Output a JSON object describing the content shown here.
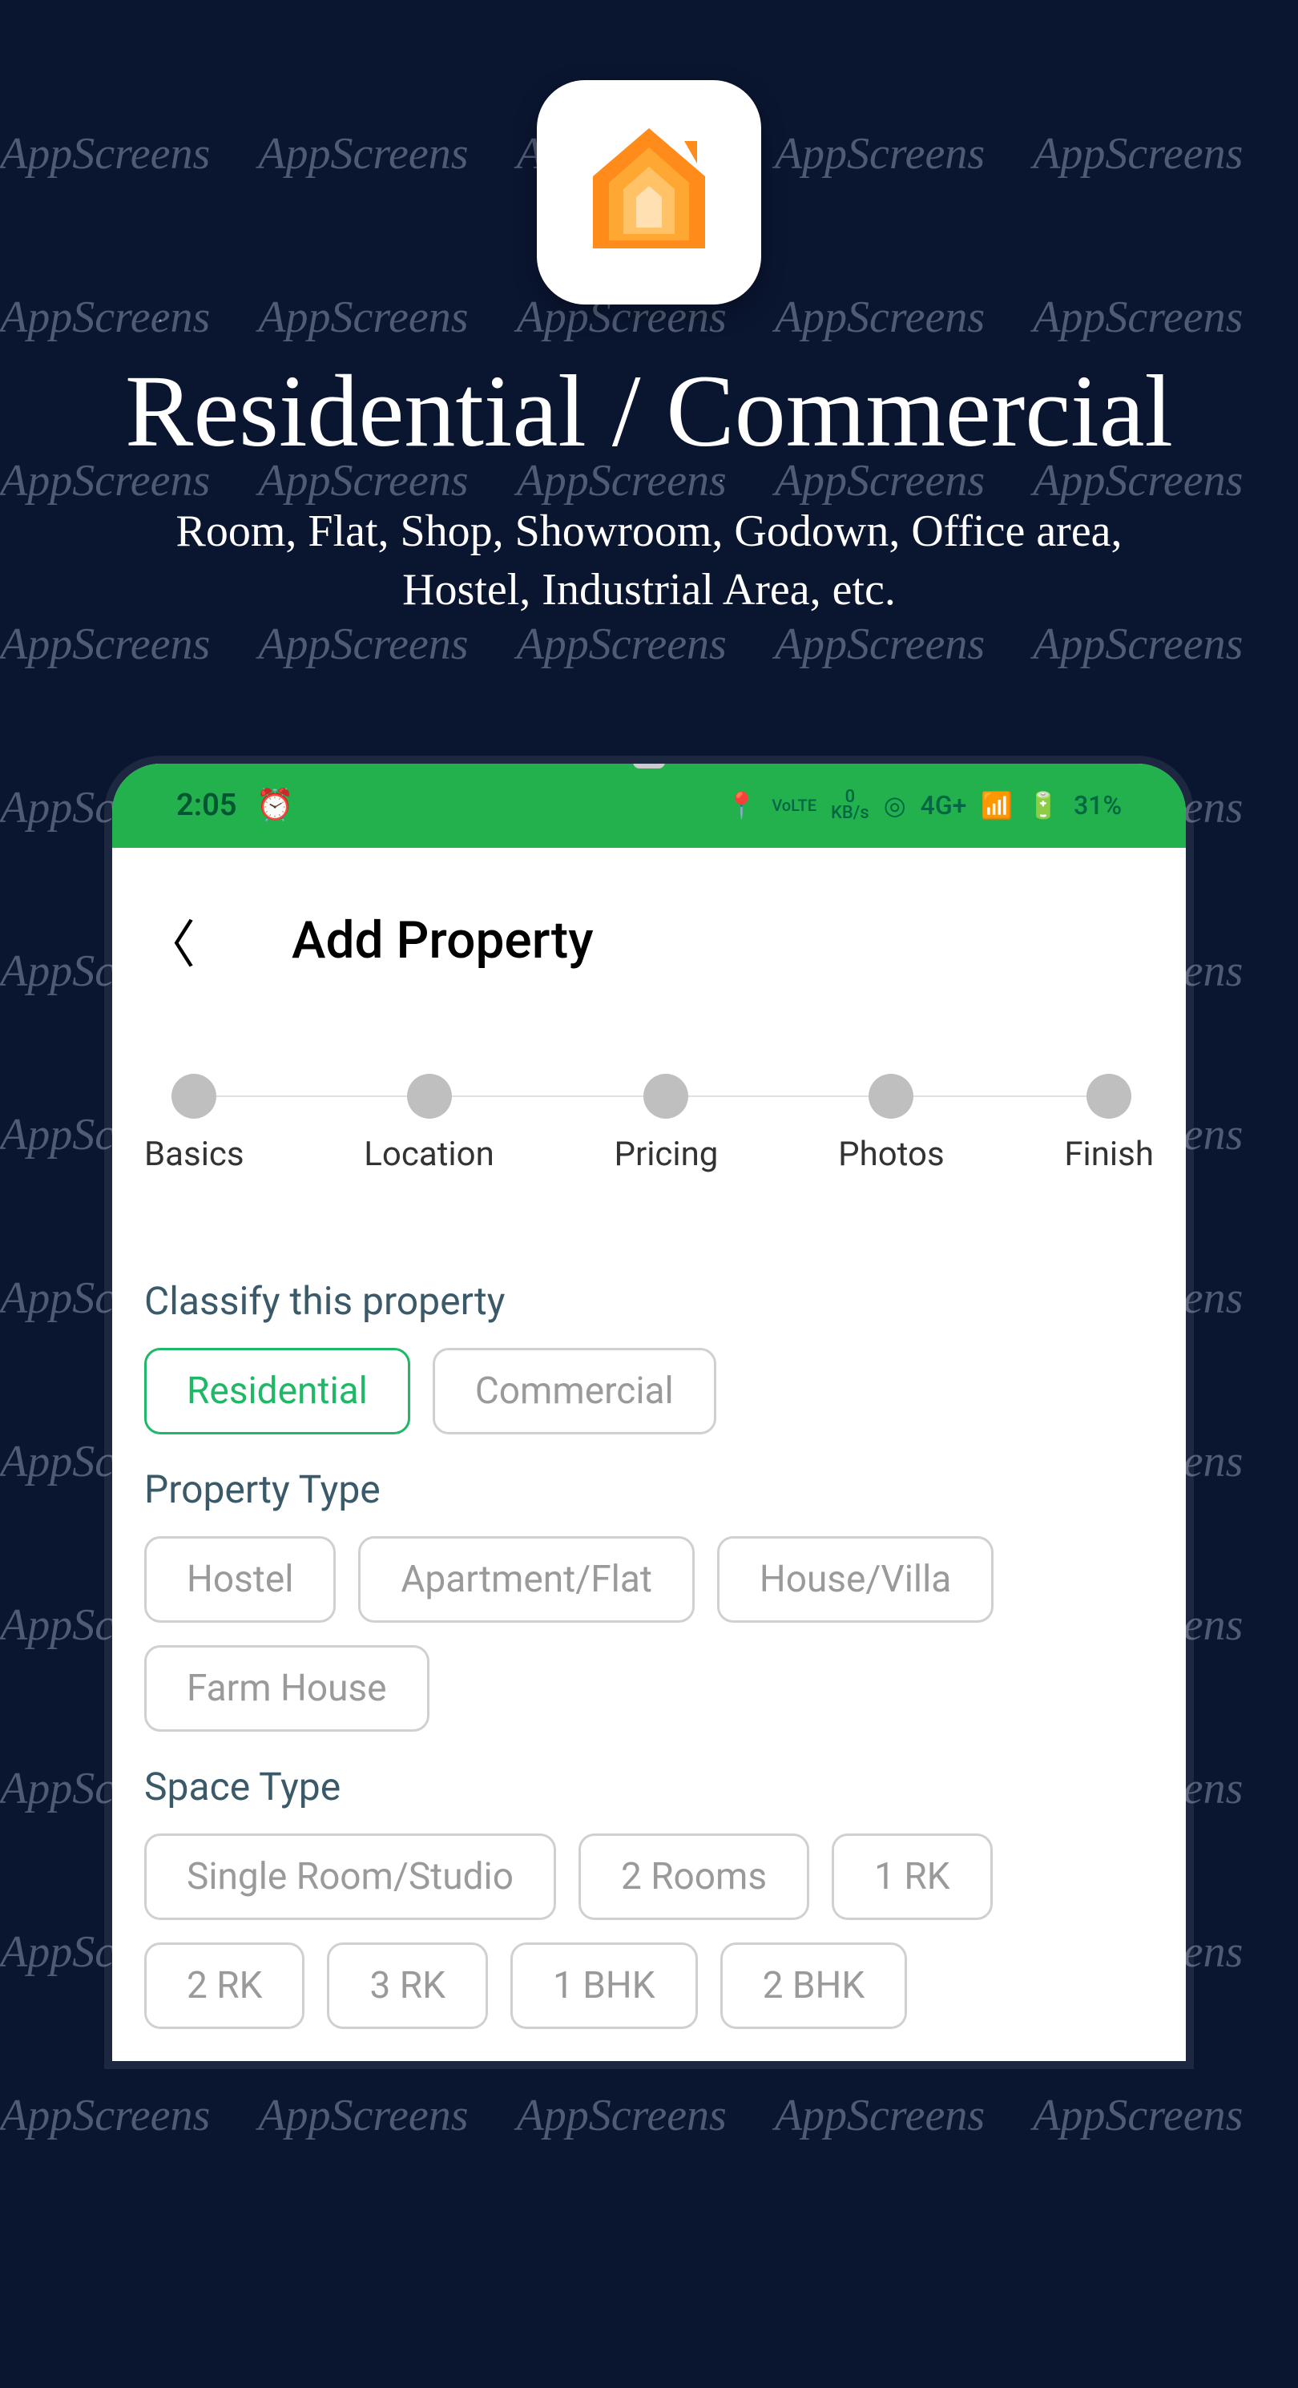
{
  "watermark": "AppScreens",
  "hero": {
    "title": "Residential / Commercial",
    "subtitle": "Room, Flat, Shop, Showroom, Godown, Office area, Hostel, Industrial Area, etc."
  },
  "status_bar": {
    "time": "2:05",
    "net_top": "0",
    "net_bottom": "KB/s",
    "lte": "VoLTE",
    "conn": "4G+",
    "battery": "31%"
  },
  "screen": {
    "title": "Add Property",
    "steps": [
      "Basics",
      "Location",
      "Pricing",
      "Photos",
      "Finish"
    ],
    "classify_label": "Classify this property",
    "classify_options": [
      {
        "label": "Residential",
        "selected": true
      },
      {
        "label": "Commercial",
        "selected": false
      }
    ],
    "property_type_label": "Property Type",
    "property_type_options": [
      {
        "label": "Hostel"
      },
      {
        "label": "Apartment/Flat"
      },
      {
        "label": "House/Villa"
      },
      {
        "label": "Farm House"
      }
    ],
    "space_type_label": "Space Type",
    "space_type_options": [
      {
        "label": "Single Room/Studio"
      },
      {
        "label": "2 Rooms"
      },
      {
        "label": "1 RK"
      },
      {
        "label": "2 RK"
      },
      {
        "label": "3 RK"
      },
      {
        "label": "1 BHK"
      },
      {
        "label": "2 BHK"
      }
    ]
  }
}
